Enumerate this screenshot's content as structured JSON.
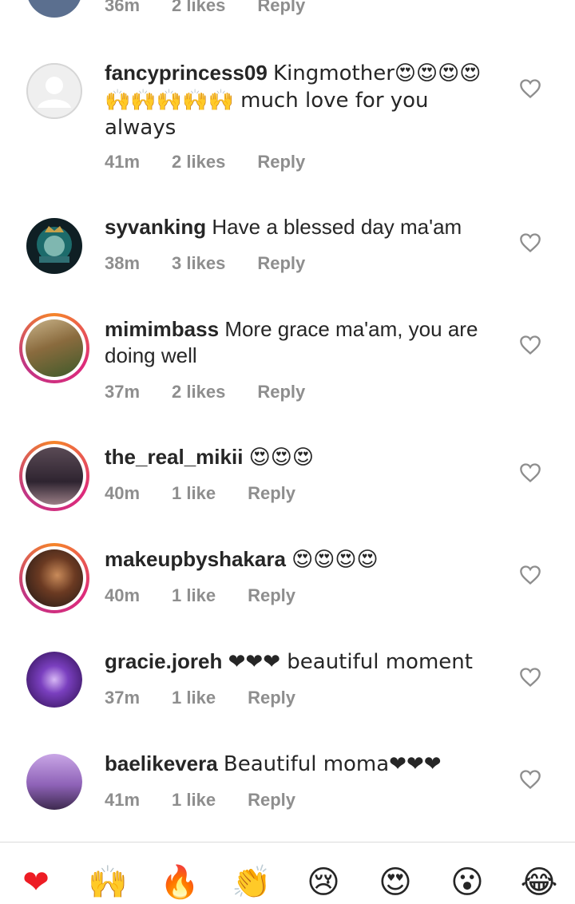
{
  "top_partial": {
    "time": "36m",
    "likes": "2 likes",
    "reply": "Reply"
  },
  "comments": [
    {
      "username": "fancyprincess09",
      "text": "Kingmother😍😍😍😍🙌🙌🙌🙌🙌 much love for you always",
      "time": "41m",
      "likes": "2 likes",
      "reply": "Reply"
    },
    {
      "username": "syvanking",
      "text": "Have a blessed day ma'am",
      "time": "38m",
      "likes": "3 likes",
      "reply": "Reply"
    },
    {
      "username": "mimimbass",
      "text": "More grace ma'am, you are doing well",
      "time": "37m",
      "likes": "2 likes",
      "reply": "Reply"
    },
    {
      "username": "the_real_mikii",
      "text": "😍😍😍",
      "time": "40m",
      "likes": "1 like",
      "reply": "Reply"
    },
    {
      "username": "makeupbyshakara",
      "text": "😍😍😍😍",
      "time": "40m",
      "likes": "1 like",
      "reply": "Reply"
    },
    {
      "username": "gracie.joreh",
      "text": "❤❤❤ beautiful moment",
      "time": "37m",
      "likes": "1 like",
      "reply": "Reply"
    },
    {
      "username": "baelikevera",
      "text": "Beautiful moma❤❤❤",
      "time": "41m",
      "likes": "1 like",
      "reply": "Reply"
    }
  ],
  "reactions": [
    "❤",
    "🙌",
    "🔥",
    "👏",
    "😢",
    "😍",
    "😮",
    "😂"
  ],
  "colors": {
    "text": "#262626",
    "meta": "#8e8e8e",
    "heart_red": "#ed1c24",
    "ring_start": "#f58529",
    "ring_end": "#dd2a7b"
  },
  "icons": [
    "heart-outline-icon",
    "default-avatar-icon"
  ]
}
